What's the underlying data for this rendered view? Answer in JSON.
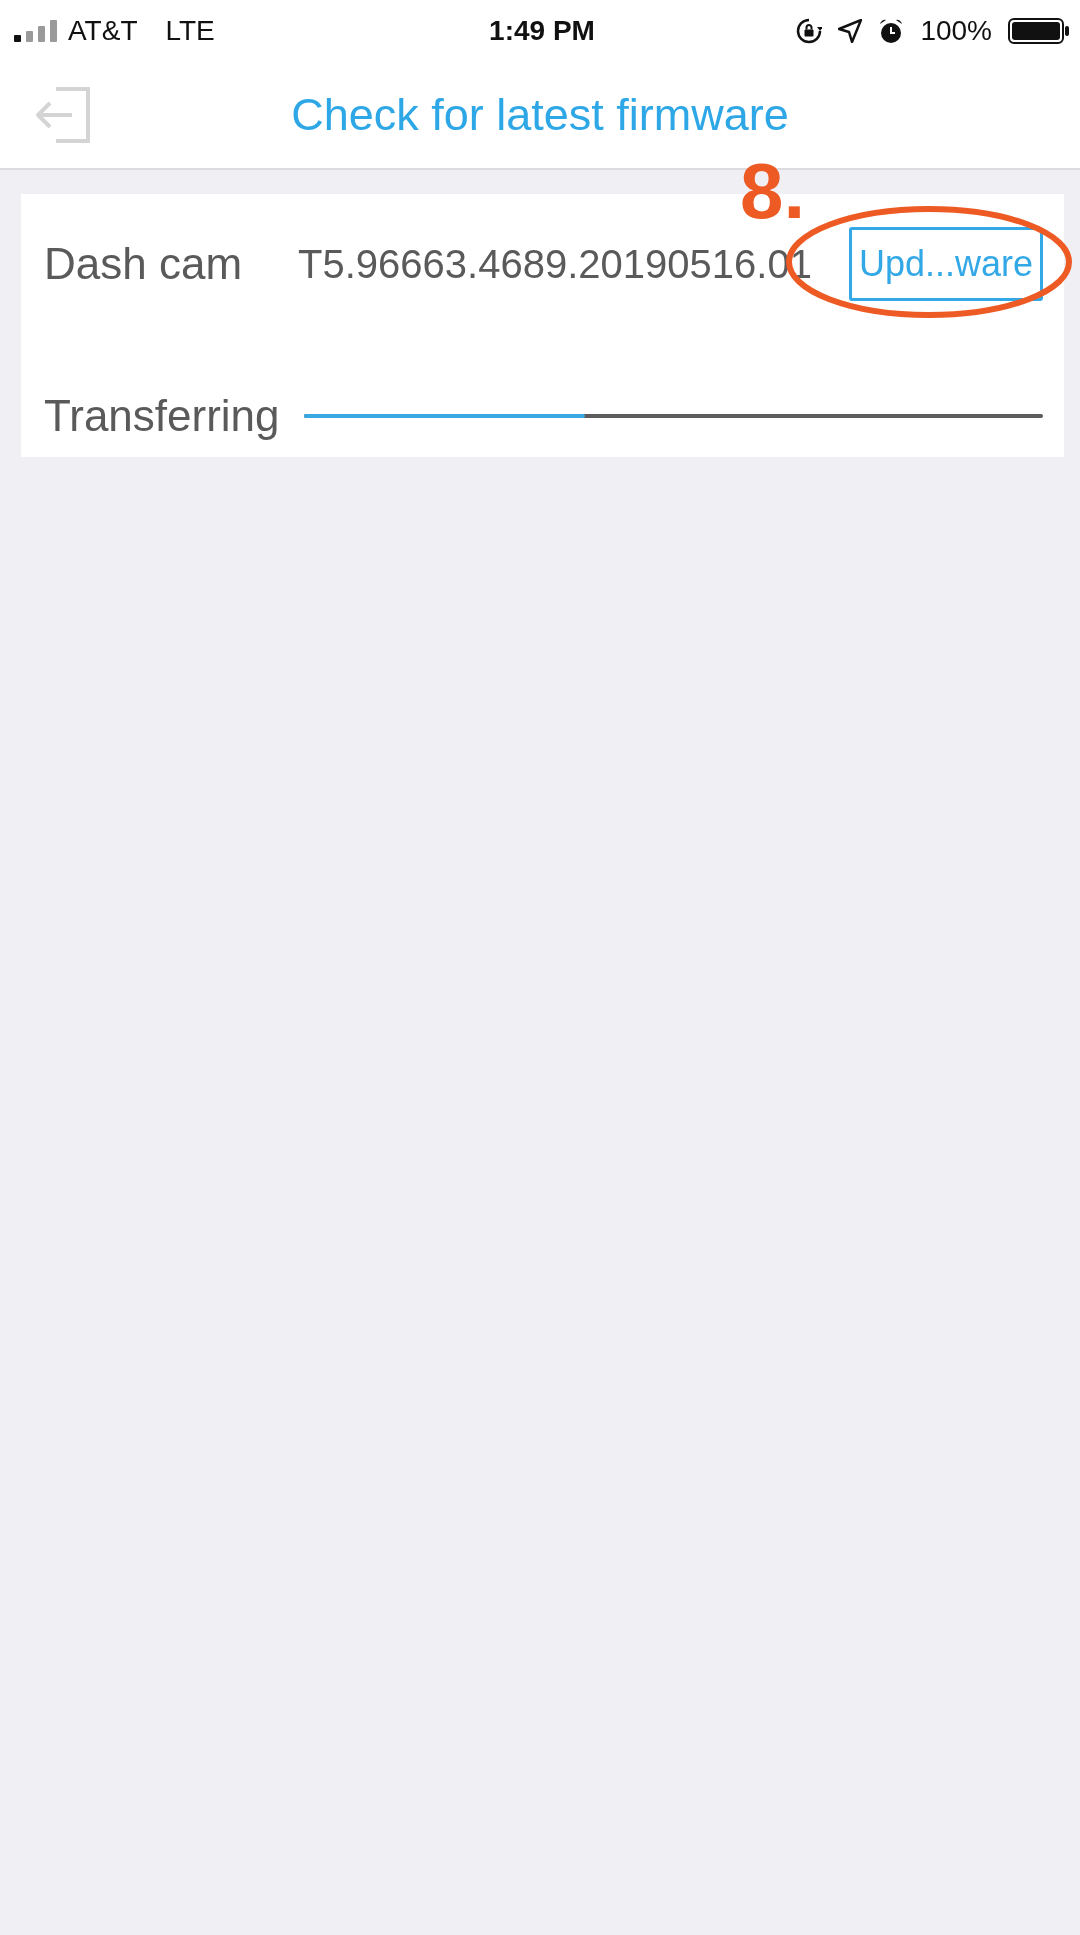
{
  "status_bar": {
    "carrier": "AT&T",
    "network": "LTE",
    "time": "1:49 PM",
    "battery": "100%"
  },
  "header": {
    "title": "Check for latest firmware"
  },
  "firmware_card": {
    "device_label": "Dash cam",
    "version": "T5.96663.4689.20190516.01",
    "update_button": "Upd...ware",
    "transfer_label": "Transferring",
    "transfer_progress": {
      "level": 0.38
    }
  },
  "annotation": {
    "label": "8."
  }
}
